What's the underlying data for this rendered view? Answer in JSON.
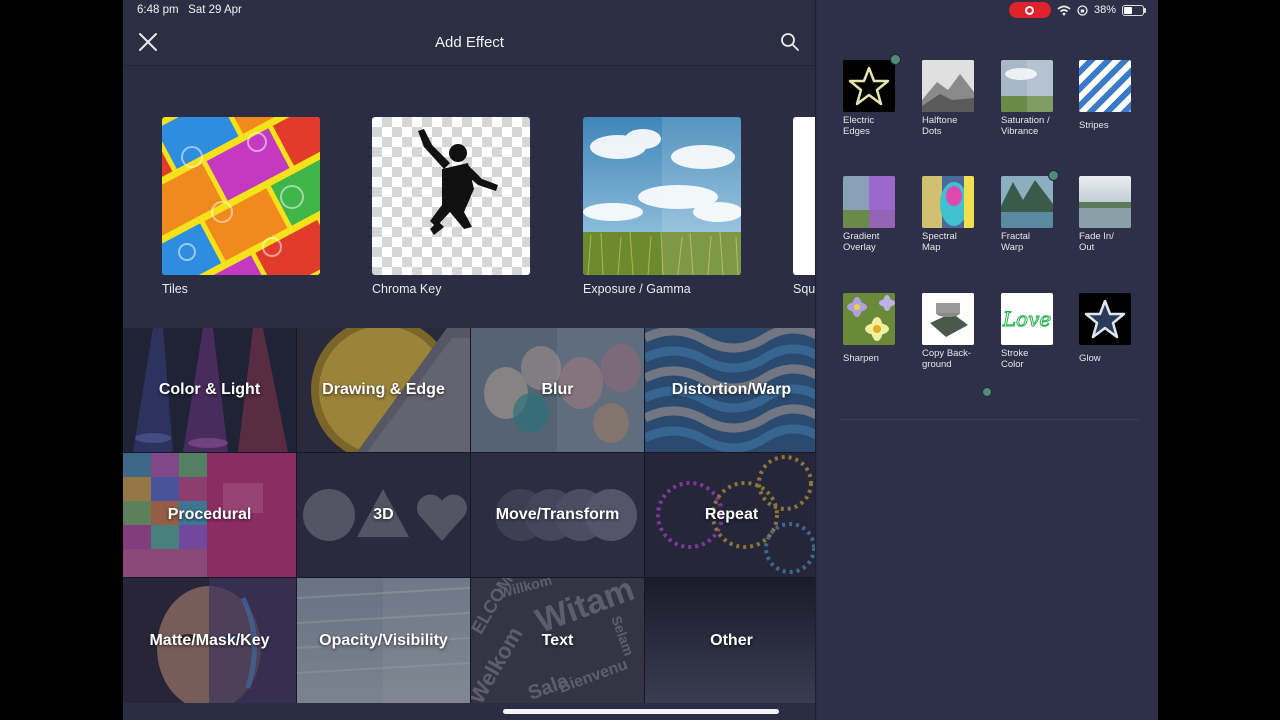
{
  "status_bar": {
    "time": "6:48 pm",
    "date": "Sat 29 Apr",
    "battery": "38%"
  },
  "header": {
    "title": "Add Effect"
  },
  "featured": [
    {
      "label": "Tiles"
    },
    {
      "label": "Chroma Key"
    },
    {
      "label": "Exposure / Gamma"
    },
    {
      "label": "Squ"
    }
  ],
  "categories": [
    {
      "label": "Color & Light"
    },
    {
      "label": "Drawing & Edge"
    },
    {
      "label": "Blur"
    },
    {
      "label": "Distortion/Warp"
    },
    {
      "label": "Procedural"
    },
    {
      "label": "3D"
    },
    {
      "label": "Move/Transform"
    },
    {
      "label": "Repeat"
    },
    {
      "label": "Matte/Mask/Key"
    },
    {
      "label": "Opacity/Visibility"
    },
    {
      "label": "Text"
    },
    {
      "label": "Other"
    }
  ],
  "category_text_words": [
    "Witam",
    "ELCOME",
    "Willkom",
    "Bienvenu",
    "Selam",
    "Welkom",
    "Sala"
  ],
  "effects": [
    {
      "label": "Electric Edges",
      "line1": "Electric",
      "line2": "Edges"
    },
    {
      "label": "Halftone Dots",
      "line1": "Halftone",
      "line2": "Dots"
    },
    {
      "label": "Saturation / Vibrance",
      "line1": "Saturation /",
      "line2": "Vibrance"
    },
    {
      "label": "Stripes",
      "line1": "Stripes",
      "line2": ""
    },
    {
      "label": "Gradient Overlay",
      "line1": "Gradient",
      "line2": "Overlay"
    },
    {
      "label": "Spectral Map",
      "line1": "Spectral",
      "line2": "Map"
    },
    {
      "label": "Fractal Warp",
      "line1": "Fractal",
      "line2": "Warp"
    },
    {
      "label": "Fade In/ Out",
      "line1": "Fade In/",
      "line2": "Out"
    },
    {
      "label": "Sharpen",
      "line1": "Sharpen",
      "line2": ""
    },
    {
      "label": "Copy Background",
      "line1": "Copy Back-",
      "line2": "ground"
    },
    {
      "label": "Stroke Color",
      "line1": "Stroke",
      "line2": "Color"
    },
    {
      "label": "Glow",
      "line1": "Glow",
      "line2": ""
    }
  ],
  "stroke_thumb_text": "Love",
  "colors": {
    "background": "#2b2d44",
    "right_panel": "#2e3049",
    "accent_badge": "#4f8a7d",
    "record": "#e0232a"
  }
}
